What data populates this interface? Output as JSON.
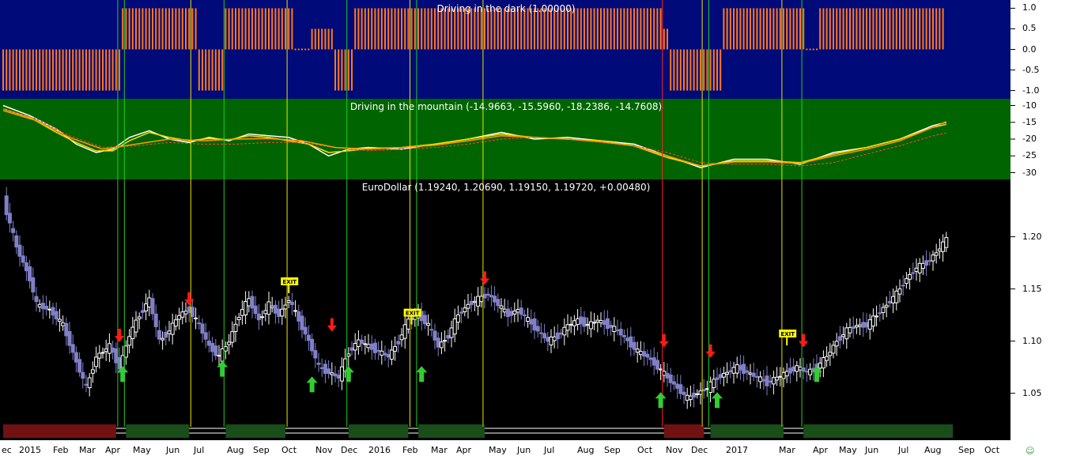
{
  "colors": {
    "oscillator_bg": "#000a78",
    "indicator_bg": "#006400",
    "price_bg": "#000000",
    "orange": "#ff7a1a",
    "bull_candle": "#ffffff",
    "bear_candle": "#8080c8",
    "buy_arrow": "#33cc33",
    "sell_arrow": "#ff1a1a",
    "exit_flag": "#ffff00",
    "vline_green": "#22cc22",
    "vline_yellow": "#e6e600",
    "vline_red": "#ff2020"
  },
  "x_axis": {
    "labels": [
      "ec",
      "2015",
      "Feb",
      "Mar",
      "Apr",
      "May",
      "Jun",
      "Jul",
      "Aug",
      "Sep",
      "Oct",
      "Nov",
      "Dec",
      "2016",
      "Feb",
      "Mar",
      "Apr",
      "May",
      "Jun",
      "Jul",
      "Aug",
      "Sep",
      "Oct",
      "Nov",
      "Dec",
      "2017",
      "Mar",
      "Apr",
      "May",
      "Jun",
      "Jul",
      "Aug",
      "Sep",
      "Oct"
    ]
  },
  "chart_data": [
    {
      "type": "bar",
      "title": "Driving in the  dark (1.00000)",
      "ylim": [
        -1.2,
        1.2
      ],
      "yticks": [
        "1.0",
        "0.5",
        "0.0",
        "-0.5",
        "-1.0"
      ],
      "segments": [
        {
          "from_week": 0,
          "to_week": 35,
          "value": -1.0
        },
        {
          "from_week": 36,
          "to_week": 58,
          "value": 1.0
        },
        {
          "from_week": 59,
          "to_week": 66,
          "value": -1.0
        },
        {
          "from_week": 67,
          "to_week": 87,
          "value": 1.0
        },
        {
          "from_week": 88,
          "to_week": 92,
          "value": 0.0
        },
        {
          "from_week": 93,
          "to_week": 99,
          "value": 0.5
        },
        {
          "from_week": 100,
          "to_week": 105,
          "value": -1.0
        },
        {
          "from_week": 106,
          "to_week": 198,
          "value": 1.0
        },
        {
          "from_week": 199,
          "to_week": 200,
          "value": 0.5
        },
        {
          "from_week": 201,
          "to_week": 216,
          "value": -1.0
        },
        {
          "from_week": 217,
          "to_week": 241,
          "value": 1.0
        },
        {
          "from_week": 242,
          "to_week": 245,
          "value": 0.0
        },
        {
          "from_week": 246,
          "to_week": 283,
          "value": 1.0
        }
      ]
    },
    {
      "type": "line",
      "title": "Driving in the  mountain (-14.9663, -15.5960, -18.2386, -14.7608)",
      "ylim": [
        -32,
        -8
      ],
      "yticks": [
        "-10",
        "-15",
        "-20",
        "-25",
        "-30"
      ],
      "series": [
        {
          "color": "#ffffff",
          "points": [
            [
              0,
              -10
            ],
            [
              8,
              -13
            ],
            [
              16,
              -17
            ],
            [
              22,
              -21.5
            ],
            [
              28,
              -24
            ],
            [
              33,
              -23
            ],
            [
              38,
              -19.5
            ],
            [
              44,
              -17.5
            ],
            [
              50,
              -20
            ],
            [
              56,
              -21
            ],
            [
              62,
              -19.5
            ],
            [
              68,
              -20.5
            ],
            [
              74,
              -18.5
            ],
            [
              80,
              -19
            ],
            [
              86,
              -19.5
            ],
            [
              92,
              -21.5
            ],
            [
              98,
              -25
            ],
            [
              104,
              -23
            ],
            [
              110,
              -22.5
            ],
            [
              120,
              -23
            ],
            [
              130,
              -21.5
            ],
            [
              140,
              -20
            ],
            [
              150,
              -18
            ],
            [
              160,
              -20
            ],
            [
              170,
              -19.5
            ],
            [
              180,
              -20.5
            ],
            [
              190,
              -21.5
            ],
            [
              200,
              -25
            ],
            [
              210,
              -28.5
            ],
            [
              220,
              -26
            ],
            [
              230,
              -26
            ],
            [
              240,
              -27.5
            ],
            [
              250,
              -24
            ],
            [
              260,
              -22.5
            ],
            [
              270,
              -20
            ],
            [
              280,
              -16
            ],
            [
              284,
              -15
            ]
          ]
        },
        {
          "color": "#ffd700",
          "points": [
            [
              0,
              -11
            ],
            [
              8,
              -13.5
            ],
            [
              16,
              -18
            ],
            [
              22,
              -21
            ],
            [
              28,
              -23.5
            ],
            [
              33,
              -23.5
            ],
            [
              38,
              -20.5
            ],
            [
              44,
              -18
            ],
            [
              50,
              -19.5
            ],
            [
              56,
              -20.5
            ],
            [
              62,
              -19.8
            ],
            [
              68,
              -20.2
            ],
            [
              74,
              -19
            ],
            [
              80,
              -19.5
            ],
            [
              86,
              -20.5
            ],
            [
              92,
              -21.5
            ],
            [
              98,
              -24
            ],
            [
              104,
              -23.5
            ],
            [
              110,
              -22.8
            ],
            [
              120,
              -22.5
            ],
            [
              130,
              -21.5
            ],
            [
              140,
              -20
            ],
            [
              150,
              -18.5
            ],
            [
              160,
              -19.5
            ],
            [
              170,
              -20
            ],
            [
              180,
              -20.5
            ],
            [
              190,
              -22
            ],
            [
              200,
              -25.5
            ],
            [
              210,
              -28
            ],
            [
              220,
              -26.5
            ],
            [
              230,
              -26.5
            ],
            [
              240,
              -27
            ],
            [
              250,
              -24.5
            ],
            [
              260,
              -22.5
            ],
            [
              270,
              -20
            ],
            [
              280,
              -16.5
            ],
            [
              284,
              -15.6
            ]
          ]
        },
        {
          "color": "#ff4040",
          "dashed": true,
          "points": [
            [
              0,
              -11
            ],
            [
              10,
              -14
            ],
            [
              20,
              -19
            ],
            [
              30,
              -22.5
            ],
            [
              40,
              -22
            ],
            [
              50,
              -21
            ],
            [
              60,
              -21.5
            ],
            [
              70,
              -21.5
            ],
            [
              80,
              -21
            ],
            [
              90,
              -21
            ],
            [
              100,
              -22.5
            ],
            [
              110,
              -23.5
            ],
            [
              120,
              -23
            ],
            [
              130,
              -22.5
            ],
            [
              140,
              -21.5
            ],
            [
              150,
              -20
            ],
            [
              160,
              -19.5
            ],
            [
              170,
              -20
            ],
            [
              180,
              -21
            ],
            [
              190,
              -22
            ],
            [
              200,
              -24
            ],
            [
              210,
              -27
            ],
            [
              220,
              -27.5
            ],
            [
              230,
              -27.5
            ],
            [
              240,
              -28
            ],
            [
              250,
              -27
            ],
            [
              260,
              -24.5
            ],
            [
              270,
              -22
            ],
            [
              280,
              -19
            ],
            [
              284,
              -18.2
            ]
          ]
        },
        {
          "color": "#ff9900",
          "points": [
            [
              0,
              -11.5
            ],
            [
              10,
              -14.5
            ],
            [
              20,
              -19.5
            ],
            [
              30,
              -23
            ],
            [
              40,
              -21.5
            ],
            [
              50,
              -20
            ],
            [
              60,
              -20.5
            ],
            [
              70,
              -20
            ],
            [
              80,
              -19.8
            ],
            [
              90,
              -20.5
            ],
            [
              100,
              -22.5
            ],
            [
              110,
              -23
            ],
            [
              120,
              -22.5
            ],
            [
              130,
              -21.8
            ],
            [
              140,
              -20.5
            ],
            [
              150,
              -19
            ],
            [
              160,
              -19.5
            ],
            [
              170,
              -20
            ],
            [
              180,
              -20.8
            ],
            [
              190,
              -22
            ],
            [
              200,
              -25
            ],
            [
              210,
              -28
            ],
            [
              220,
              -26.8
            ],
            [
              230,
              -26.8
            ],
            [
              240,
              -27.2
            ],
            [
              250,
              -25
            ],
            [
              260,
              -23
            ],
            [
              270,
              -20.5
            ],
            [
              280,
              -16.5
            ],
            [
              284,
              -14.8
            ]
          ]
        }
      ]
    },
    {
      "type": "candlestick",
      "title": "EuroDollar (1.19240, 1.20690, 1.19150, 1.19720, +0.00480)",
      "ylim": [
        1.005,
        1.255
      ],
      "yticks": [
        "1.20",
        "1.15",
        "1.10",
        "1.05"
      ],
      "closes": [
        [
          0,
          1.235
        ],
        [
          4,
          1.19
        ],
        [
          8,
          1.16
        ],
        [
          10,
          1.135
        ],
        [
          14,
          1.13
        ],
        [
          18,
          1.115
        ],
        [
          22,
          1.08
        ],
        [
          25,
          1.055
        ],
        [
          28,
          1.085
        ],
        [
          32,
          1.095
        ],
        [
          35,
          1.075
        ],
        [
          38,
          1.105
        ],
        [
          41,
          1.125
        ],
        [
          44,
          1.14
        ],
        [
          47,
          1.1
        ],
        [
          50,
          1.11
        ],
        [
          53,
          1.125
        ],
        [
          56,
          1.13
        ],
        [
          59,
          1.115
        ],
        [
          62,
          1.095
        ],
        [
          65,
          1.085
        ],
        [
          68,
          1.1
        ],
        [
          71,
          1.125
        ],
        [
          74,
          1.14
        ],
        [
          77,
          1.12
        ],
        [
          80,
          1.135
        ],
        [
          83,
          1.125
        ],
        [
          86,
          1.14
        ],
        [
          89,
          1.12
        ],
        [
          92,
          1.1
        ],
        [
          95,
          1.075
        ],
        [
          98,
          1.07
        ],
        [
          101,
          1.065
        ],
        [
          104,
          1.09
        ],
        [
          107,
          1.1
        ],
        [
          110,
          1.095
        ],
        [
          113,
          1.09
        ],
        [
          116,
          1.085
        ],
        [
          119,
          1.1
        ],
        [
          122,
          1.12
        ],
        [
          125,
          1.125
        ],
        [
          128,
          1.115
        ],
        [
          131,
          1.095
        ],
        [
          134,
          1.105
        ],
        [
          137,
          1.125
        ],
        [
          140,
          1.135
        ],
        [
          143,
          1.14
        ],
        [
          146,
          1.145
        ],
        [
          149,
          1.135
        ],
        [
          152,
          1.125
        ],
        [
          155,
          1.13
        ],
        [
          158,
          1.12
        ],
        [
          161,
          1.11
        ],
        [
          164,
          1.1
        ],
        [
          167,
          1.105
        ],
        [
          170,
          1.115
        ],
        [
          173,
          1.12
        ],
        [
          176,
          1.115
        ],
        [
          179,
          1.12
        ],
        [
          182,
          1.115
        ],
        [
          185,
          1.11
        ],
        [
          188,
          1.1
        ],
        [
          191,
          1.09
        ],
        [
          194,
          1.085
        ],
        [
          197,
          1.075
        ],
        [
          200,
          1.065
        ],
        [
          203,
          1.055
        ],
        [
          206,
          1.045
        ],
        [
          209,
          1.05
        ],
        [
          212,
          1.055
        ],
        [
          215,
          1.065
        ],
        [
          218,
          1.07
        ],
        [
          221,
          1.075
        ],
        [
          224,
          1.07
        ],
        [
          227,
          1.065
        ],
        [
          230,
          1.06
        ],
        [
          233,
          1.065
        ],
        [
          236,
          1.07
        ],
        [
          239,
          1.075
        ],
        [
          242,
          1.07
        ],
        [
          245,
          1.075
        ],
        [
          248,
          1.085
        ],
        [
          251,
          1.1
        ],
        [
          254,
          1.11
        ],
        [
          257,
          1.115
        ],
        [
          260,
          1.115
        ],
        [
          263,
          1.125
        ],
        [
          266,
          1.135
        ],
        [
          269,
          1.145
        ],
        [
          272,
          1.16
        ],
        [
          275,
          1.17
        ],
        [
          278,
          1.175
        ],
        [
          281,
          1.185
        ],
        [
          284,
          1.1972
        ]
      ],
      "buy_signals": [
        {
          "week": 36,
          "price": 1.07
        },
        {
          "week": 66,
          "price": 1.075
        },
        {
          "week": 93,
          "price": 1.06
        },
        {
          "week": 104,
          "price": 1.07
        },
        {
          "week": 126,
          "price": 1.07
        },
        {
          "week": 198,
          "price": 1.045
        },
        {
          "week": 215,
          "price": 1.045
        },
        {
          "week": 245,
          "price": 1.07
        }
      ],
      "sell_signals": [
        {
          "week": 35,
          "price": 1.105
        },
        {
          "week": 56,
          "price": 1.14
        },
        {
          "week": 99,
          "price": 1.115
        },
        {
          "week": 145,
          "price": 1.16
        },
        {
          "week": 199,
          "price": 1.1
        },
        {
          "week": 213,
          "price": 1.09
        },
        {
          "week": 241,
          "price": 1.1
        }
      ],
      "exit_signals": [
        {
          "week": 86,
          "price": 1.155,
          "label": "EXIT"
        },
        {
          "week": 123,
          "price": 1.125,
          "label": "EXIT"
        },
        {
          "week": 236,
          "price": 1.105,
          "label": "EXIT"
        }
      ],
      "signal_lines": [
        {
          "week": 34.5,
          "color": "green"
        },
        {
          "week": 36.5,
          "color": "green"
        },
        {
          "week": 56.5,
          "color": "yellow"
        },
        {
          "week": 66.5,
          "color": "green"
        },
        {
          "week": 85.5,
          "color": "yellow"
        },
        {
          "week": 103.5,
          "color": "green"
        },
        {
          "week": 122.5,
          "color": "yellow"
        },
        {
          "week": 124.5,
          "color": "green"
        },
        {
          "week": 144.5,
          "color": "yellow"
        },
        {
          "week": 198.5,
          "color": "red"
        },
        {
          "week": 210.5,
          "color": "yellow"
        },
        {
          "week": 212.5,
          "color": "green"
        },
        {
          "week": 234.5,
          "color": "yellow"
        },
        {
          "week": 240.5,
          "color": "green"
        }
      ]
    }
  ]
}
